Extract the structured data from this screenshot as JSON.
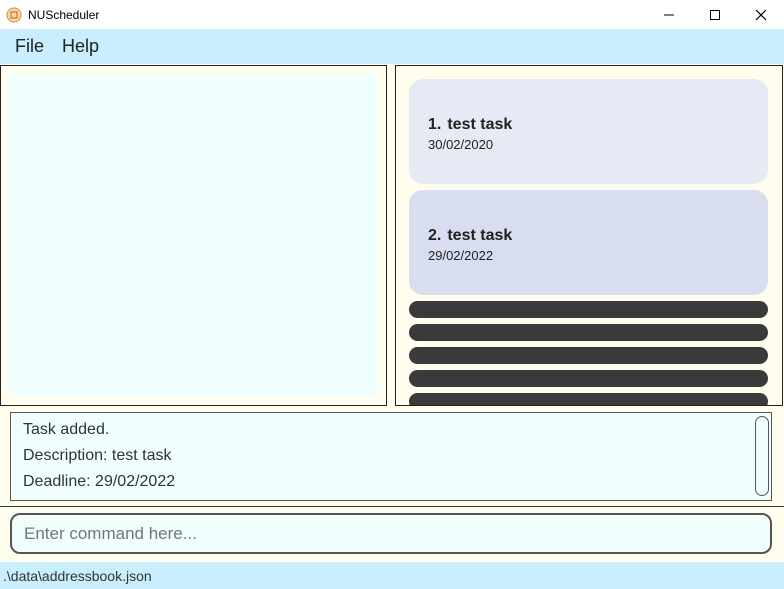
{
  "window": {
    "title": "NUScheduler",
    "app_icon": "app-logo-icon",
    "controls": [
      "minimize-icon",
      "maximize-icon",
      "close-icon"
    ]
  },
  "menu": {
    "items": [
      {
        "label": "File"
      },
      {
        "label": "Help"
      }
    ]
  },
  "tasks": [
    {
      "index": "1.",
      "name": "test task",
      "date": "30/02/2020"
    },
    {
      "index": "2.",
      "name": "test task",
      "date": "29/02/2022"
    }
  ],
  "result": {
    "lines": [
      "Task added.",
      "Description: test task",
      "Deadline: 29/02/2022"
    ]
  },
  "command": {
    "placeholder": "Enter command here..."
  },
  "status": {
    "path": ".\\data\\addressbook.json"
  },
  "colors": {
    "menu_background": "#c9eefd",
    "panel_background": "#f0fffe",
    "card_1": "#e6eaf5",
    "card_2": "#d8ddef",
    "collapsed_card": "#3a3a3a"
  }
}
